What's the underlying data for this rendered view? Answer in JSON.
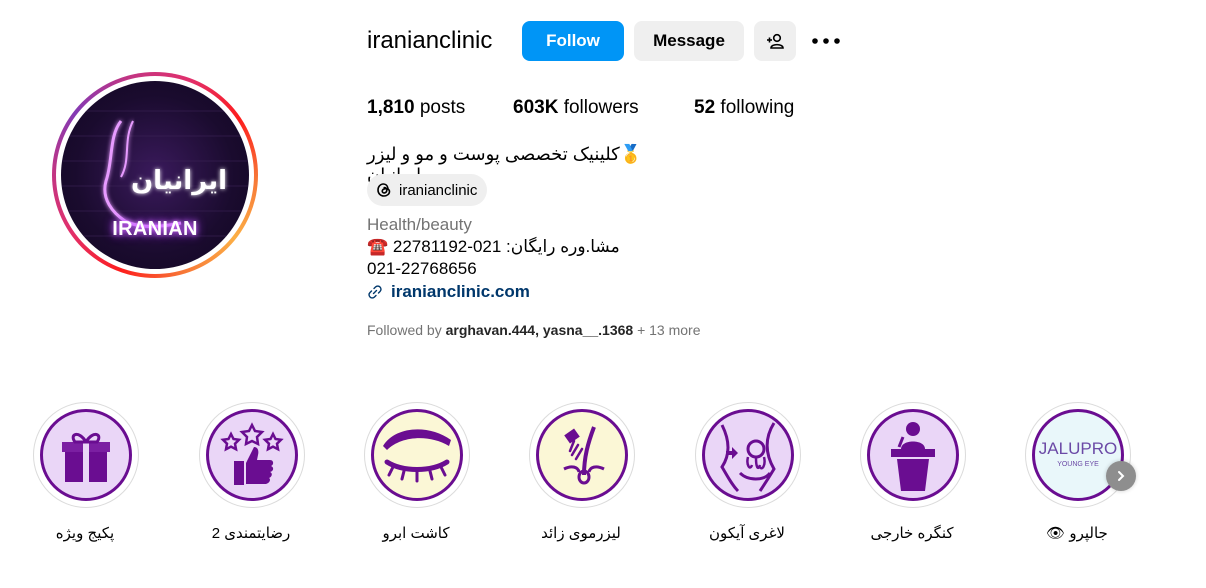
{
  "profile": {
    "username": "iranianclinic",
    "avatar_text": "IRANIAN",
    "avatar_logo_text": "ایرانیان",
    "follow_label": "Follow",
    "message_label": "Message",
    "stats": {
      "posts_count": "1,810",
      "posts_label": "posts",
      "followers_count": "603K",
      "followers_label": "followers",
      "following_count": "52",
      "following_label": "following"
    },
    "bio_name": "🥇کلینیک تخصصی پوست و مو و لیزر ایرانیان",
    "threads_handle": "iranianclinic",
    "category": "Health/beauty",
    "bio_lines": [
      "☎️ مشا.وره رایگان: 021-22781192",
      "021-22768656"
    ],
    "website": "iranianclinic.com",
    "followed_by": {
      "prefix": "Followed by",
      "users": "arghavan.444, yasna__.1368",
      "more": "+ 13 more"
    }
  },
  "highlights": [
    {
      "label": "پکیج ویژه",
      "icon": "gift-icon"
    },
    {
      "label": "رضایتمندی 2",
      "icon": "thumbs-up-stars-icon"
    },
    {
      "label": "کاشت ابرو",
      "icon": "eyebrow-eye-icon"
    },
    {
      "label": "لیزرموی زائد",
      "icon": "laser-hair-icon"
    },
    {
      "label": "لاغری آیکون",
      "icon": "body-slimming-icon"
    },
    {
      "label": "کنگره خارجی",
      "icon": "podium-speaker-icon"
    },
    {
      "label": "جالپرو 👁",
      "icon": "jalupro-logo",
      "logo_text": "JALUPRO",
      "logo_sub": "YOUNG EYE"
    }
  ],
  "colors": {
    "follow_blue": "#0095f6",
    "button_gray": "#efefef",
    "highlight_purple": "#6a0d91",
    "link_blue": "#00376b"
  }
}
